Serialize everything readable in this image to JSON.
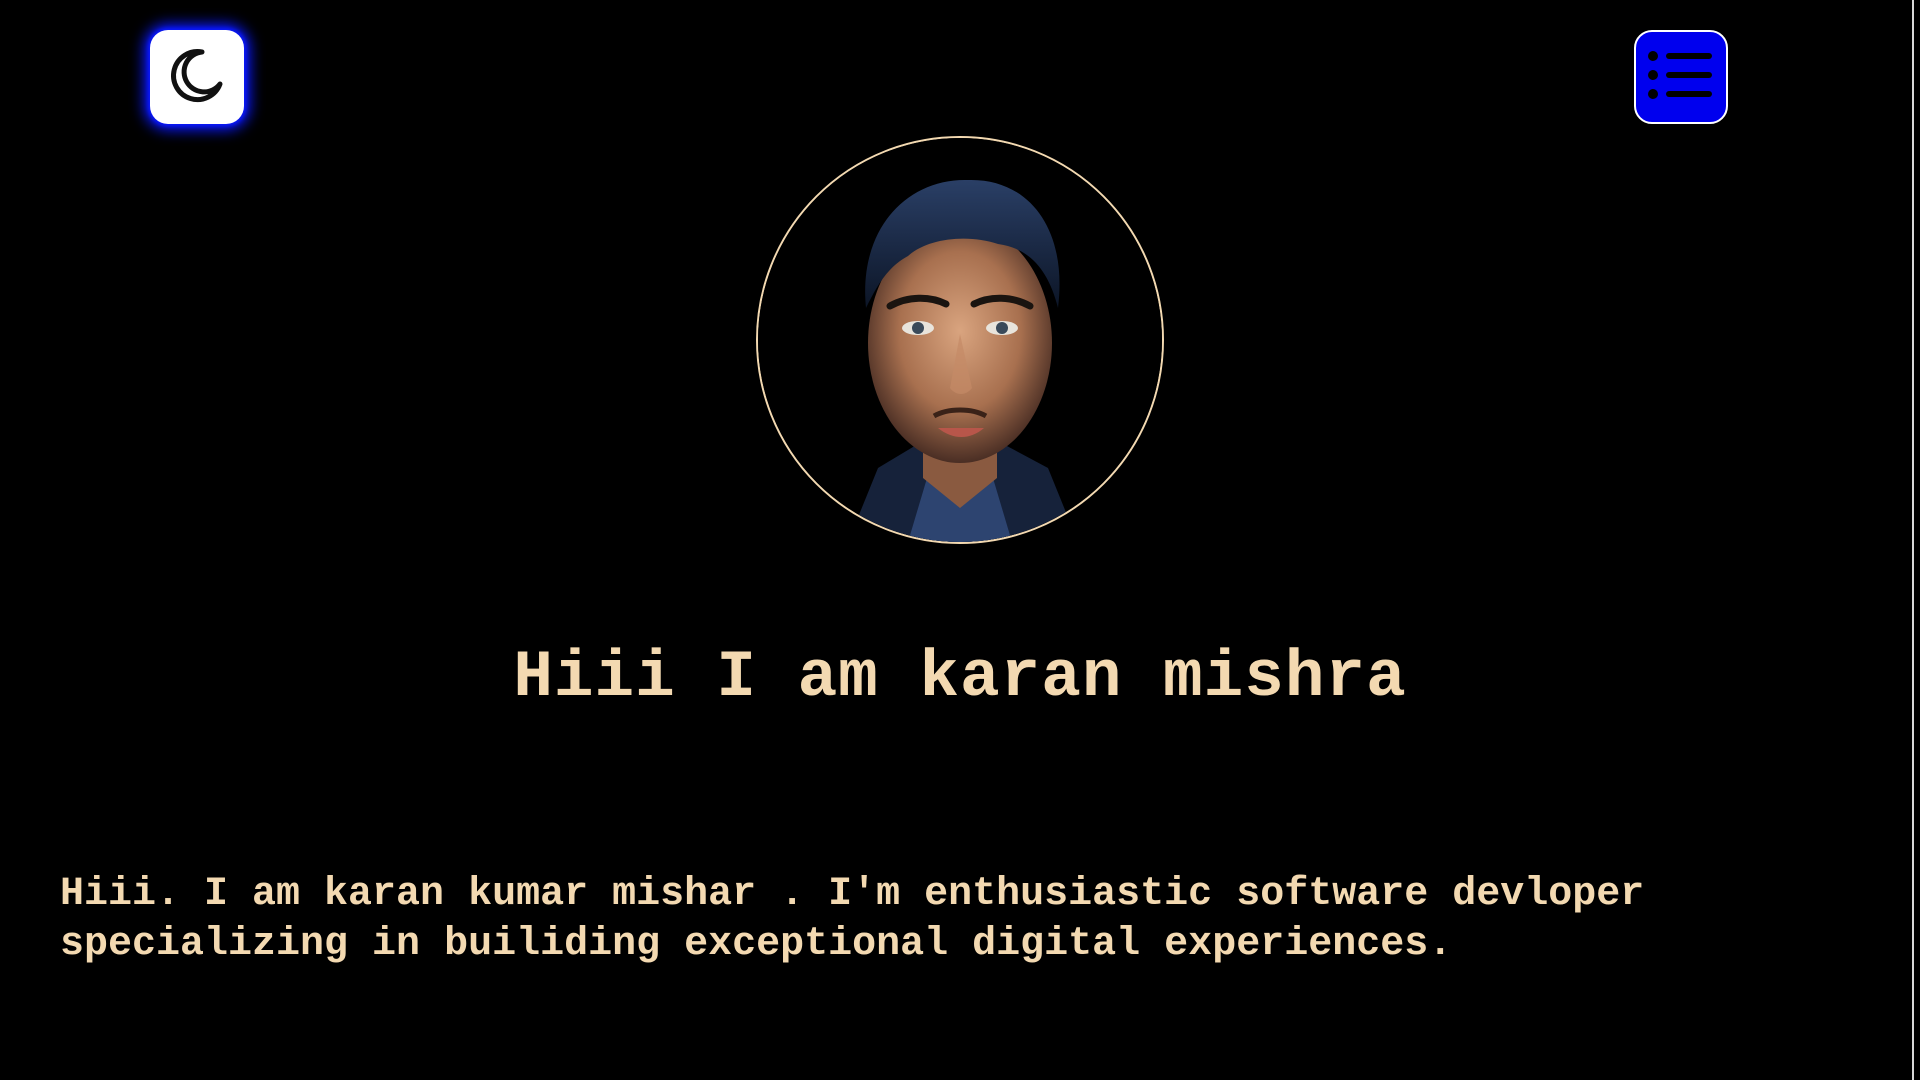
{
  "theme_toggle": {
    "icon": "moon-icon",
    "bg": "#ffffff",
    "glow": "#0a18ff"
  },
  "menu_button": {
    "icon": "list-icon",
    "bg": "#0000ee"
  },
  "avatar": {
    "image": "portrait-illustration",
    "border": "#f3d9b1"
  },
  "headline": "Hiii I am karan mishra",
  "bio": "Hiii. I am karan kumar mishar . I'm enthusiastic software devloper specializing in builiding exceptional digital experiences.",
  "colors": {
    "background": "#000000",
    "text": "#f3d9b1"
  }
}
